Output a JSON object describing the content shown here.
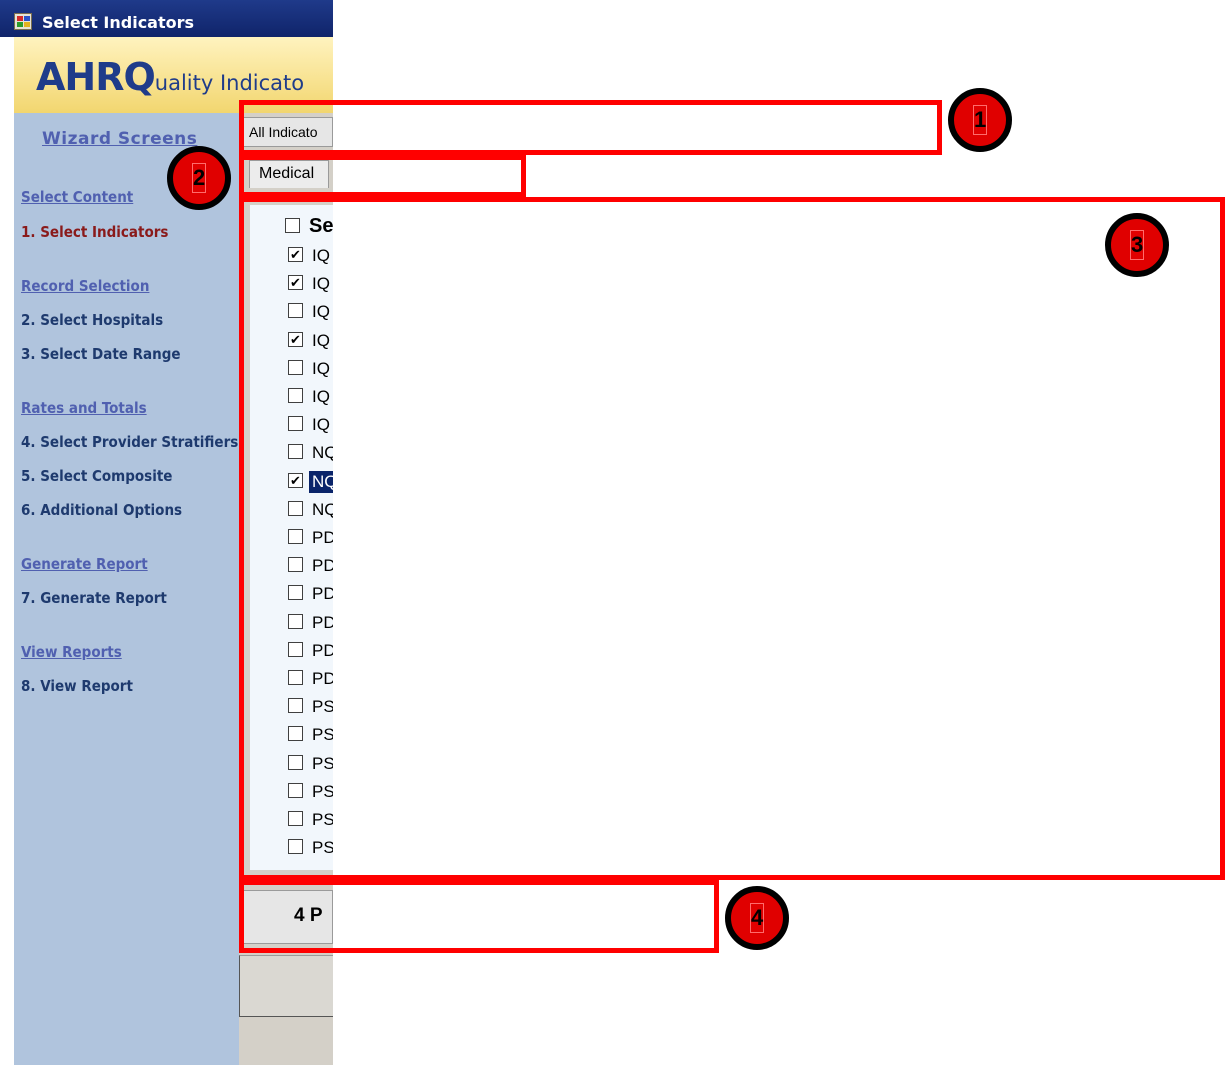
{
  "window": {
    "title": "Select Indicators"
  },
  "banner": {
    "logo_big": "AHRQ",
    "logo_small": "uality Indicato"
  },
  "sidebar": {
    "heading": "Wizard Screens",
    "items": [
      {
        "label": "Select Content",
        "kind": "section"
      },
      {
        "label": "1. Select Indicators",
        "kind": "current"
      },
      {
        "label": "Record Selection",
        "kind": "section"
      },
      {
        "label": "2. Select Hospitals",
        "kind": "step"
      },
      {
        "label": "3. Select Date Range",
        "kind": "step"
      },
      {
        "label": "Rates and Totals",
        "kind": "section"
      },
      {
        "label": "4. Select Provider Stratifiers",
        "kind": "step"
      },
      {
        "label": "5. Select Composite",
        "kind": "step"
      },
      {
        "label": "6. Additional Options",
        "kind": "step"
      },
      {
        "label": "Generate Report",
        "kind": "section"
      },
      {
        "label": "7. Generate Report",
        "kind": "step"
      },
      {
        "label": "View Reports",
        "kind": "section"
      },
      {
        "label": "8. View Report",
        "kind": "step"
      }
    ]
  },
  "main": {
    "filter_combo": "All Indicato",
    "tab_label": "Medical",
    "select_all_label": "Se",
    "list": [
      {
        "label": "IQ",
        "checked": true
      },
      {
        "label": "IQ",
        "checked": true
      },
      {
        "label": "IQ",
        "checked": false
      },
      {
        "label": "IQ",
        "checked": true
      },
      {
        "label": "IQ",
        "checked": false
      },
      {
        "label": "IQ",
        "checked": false
      },
      {
        "label": "IQ",
        "checked": false
      },
      {
        "label": "NQ",
        "checked": false
      },
      {
        "label": "NQ",
        "checked": true,
        "highlighted": true
      },
      {
        "label": "NQ",
        "checked": false
      },
      {
        "label": "PD",
        "checked": false
      },
      {
        "label": "PD",
        "checked": false
      },
      {
        "label": "PD",
        "checked": false
      },
      {
        "label": "PD",
        "checked": false
      },
      {
        "label": "PD",
        "checked": false
      },
      {
        "label": "PD",
        "checked": false
      },
      {
        "label": "PS",
        "checked": false
      },
      {
        "label": "PS",
        "checked": false
      },
      {
        "label": "PS",
        "checked": false
      },
      {
        "label": "PS",
        "checked": false
      },
      {
        "label": "PS",
        "checked": false
      },
      {
        "label": "PS",
        "checked": false
      }
    ],
    "footer_text": "4 P"
  },
  "annotations": [
    {
      "number": "1"
    },
    {
      "number": "2"
    },
    {
      "number": "3"
    },
    {
      "number": "4"
    }
  ],
  "colors": {
    "annotation": "#ff0000",
    "sidebar": "#b0c4dd",
    "titlebar": "#10246a"
  }
}
